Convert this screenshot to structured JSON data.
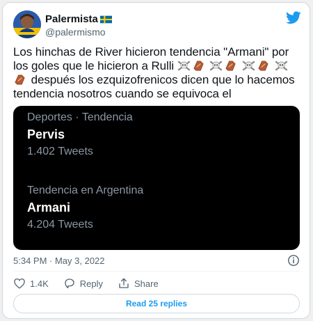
{
  "author": {
    "name": "Palermista",
    "handle": "@palermismo",
    "flag": "sweden-flag"
  },
  "tweet": {
    "text_part1": "Los hinchas de River hicieron tendencia \"Armani\" por los goles que le hicieron a Rulli",
    "text_part2": "después los ezquizofrenicos dicen que lo hacemos tendencia nosotros cuando se equivoca el",
    "emojis": [
      "skull-crossbones-icon",
      "coffin-icon",
      "skull-crossbones-icon",
      "coffin-icon",
      "skull-crossbones-icon",
      "coffin-icon",
      "skull-crossbones-icon",
      "coffin-icon"
    ]
  },
  "media": {
    "trends": [
      {
        "category": "Deportes · Tendencia",
        "topic": "Pervis",
        "count": "1.402 Tweets"
      },
      {
        "category": "Tendencia en Argentina",
        "topic": "Armani",
        "count": "4.204 Tweets"
      }
    ]
  },
  "meta": {
    "timestamp": "5:34 PM · May 3, 2022"
  },
  "actions": {
    "likes": "1.4K",
    "reply_label": "Reply",
    "share_label": "Share"
  },
  "replies_button": "Read 25 replies",
  "colors": {
    "twitter_blue": "#1d9bf0",
    "text_secondary": "#536471",
    "media_bg": "#000000"
  }
}
